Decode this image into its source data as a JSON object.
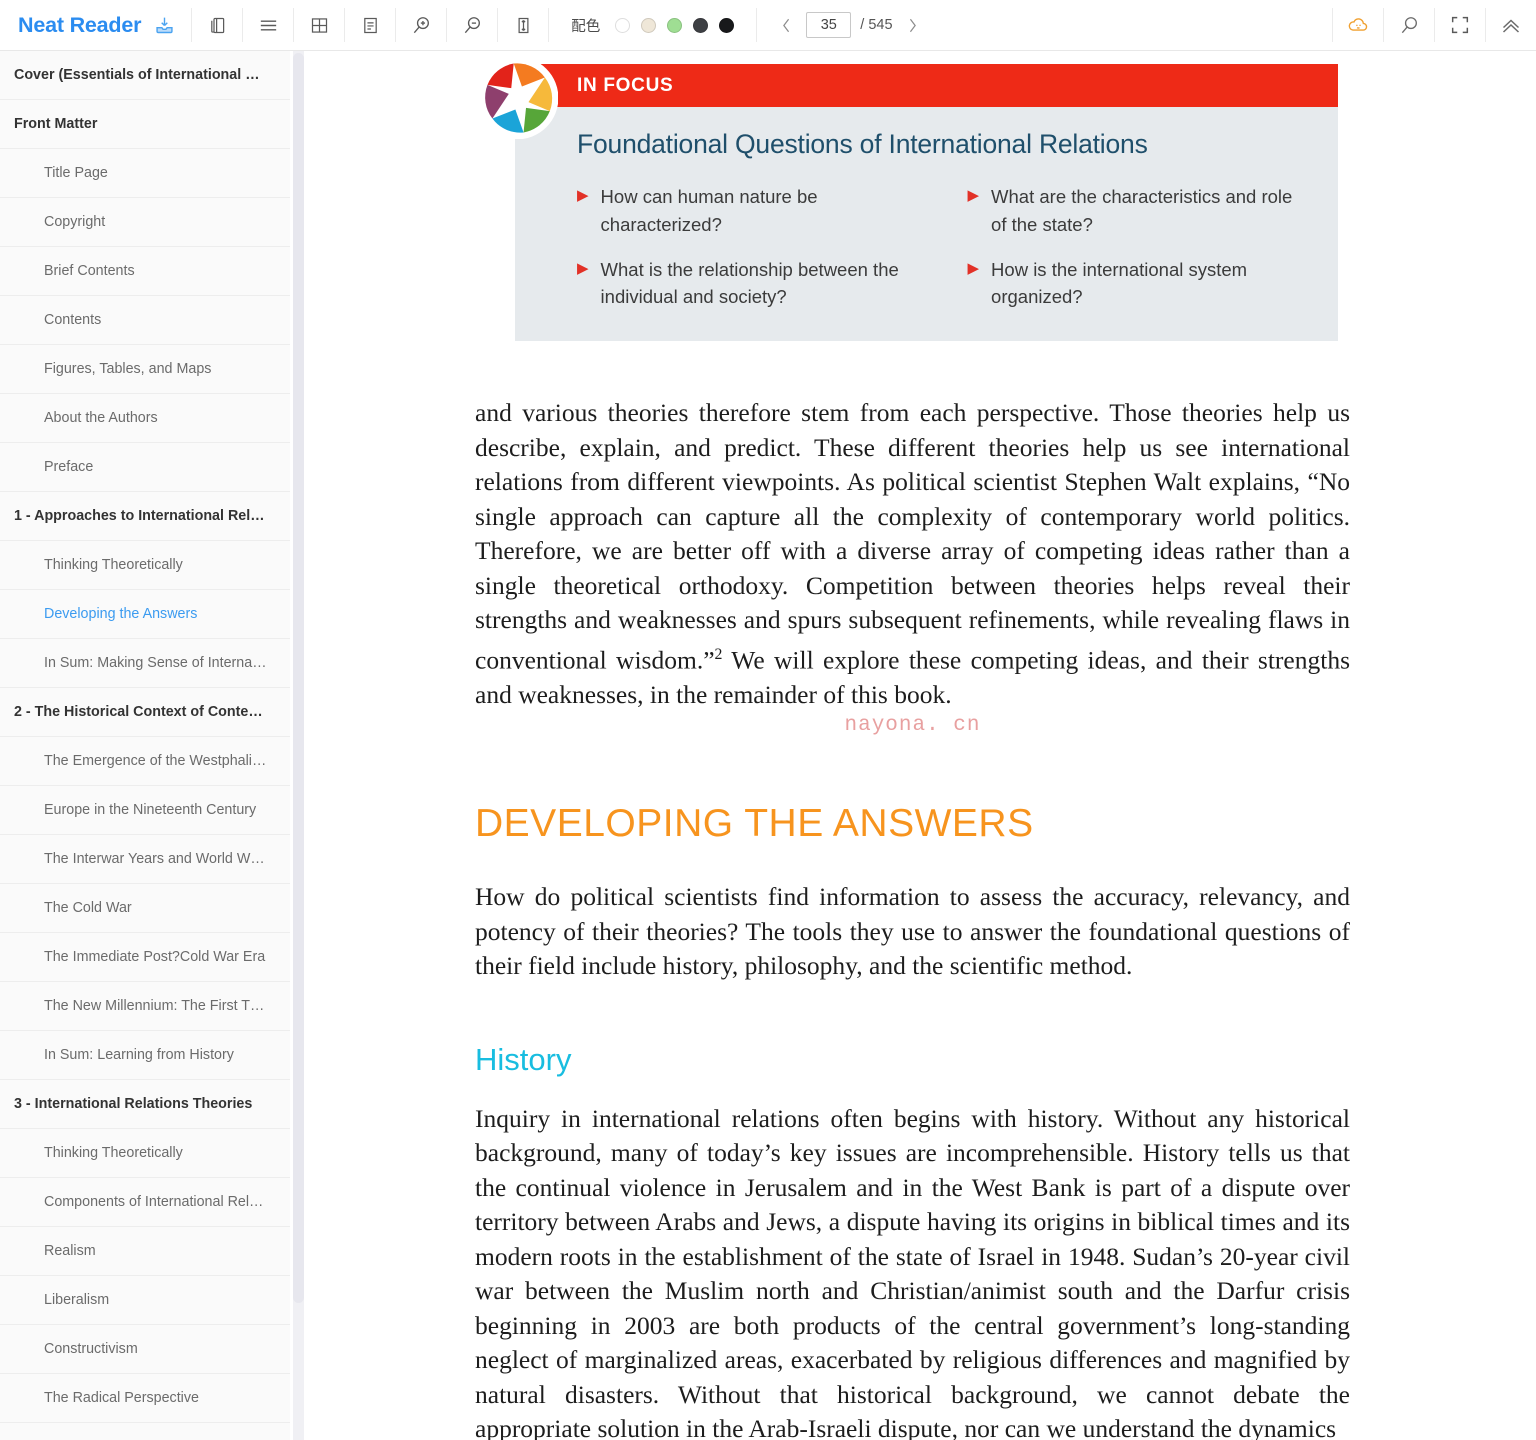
{
  "app": {
    "name": "Neat Reader"
  },
  "toolbar": {
    "save_icon": "save-download-icon",
    "icons": [
      {
        "name": "book-copy-icon",
        "label": "Book"
      },
      {
        "name": "hamburger-menu-icon",
        "label": "Contents"
      },
      {
        "name": "grid-layout-icon",
        "label": "Layout"
      },
      {
        "name": "notes-icon",
        "label": "Notes"
      },
      {
        "name": "zoom-in-icon",
        "label": "Zoom In"
      },
      {
        "name": "zoom-out-icon",
        "label": "Zoom Out"
      },
      {
        "name": "line-height-icon",
        "label": "Line Spacing"
      }
    ],
    "palette_label": "配色",
    "swatches": [
      {
        "name": "swatch-white",
        "color": "#ffffff"
      },
      {
        "name": "swatch-sepia",
        "color": "#efe7d8"
      },
      {
        "name": "swatch-green",
        "color": "#9fde93"
      },
      {
        "name": "swatch-dark-gray",
        "color": "#3e4044"
      },
      {
        "name": "swatch-black",
        "color": "#18191b"
      }
    ],
    "pager": {
      "prev": "‹",
      "next": "›",
      "current_page": "35",
      "total_pages": "/ 545",
      "placeholder": "35"
    },
    "right_icons": [
      {
        "name": "cloud-sync-icon",
        "label": "Cloud",
        "color": "#f0a030"
      },
      {
        "name": "search-icon",
        "label": "Search",
        "color": "#6b6b6b"
      },
      {
        "name": "fullscreen-icon",
        "label": "Fullscreen",
        "color": "#6b6b6b"
      },
      {
        "name": "collapse-up-icon",
        "label": "Collapse Toolbar",
        "color": "#6b6b6b"
      }
    ]
  },
  "sidebar": {
    "items": [
      {
        "label": "Cover (Essentials of International R…",
        "level": 0,
        "active": false
      },
      {
        "label": "Front Matter",
        "level": 0,
        "active": false
      },
      {
        "label": "Title Page",
        "level": 1,
        "active": false
      },
      {
        "label": "Copyright",
        "level": 1,
        "active": false
      },
      {
        "label": "Brief Contents",
        "level": 1,
        "active": false
      },
      {
        "label": "Contents",
        "level": 1,
        "active": false
      },
      {
        "label": "Figures, Tables, and Maps",
        "level": 1,
        "active": false
      },
      {
        "label": "About the Authors",
        "level": 1,
        "active": false
      },
      {
        "label": "Preface",
        "level": 1,
        "active": false
      },
      {
        "label": "1 - Approaches to International Rel…",
        "level": 0,
        "active": false
      },
      {
        "label": "Thinking Theoretically",
        "level": 1,
        "active": false
      },
      {
        "label": "Developing the Answers",
        "level": 1,
        "active": true
      },
      {
        "label": "In Sum: Making Sense of Internat…",
        "level": 1,
        "active": false
      },
      {
        "label": "2 - The Historical Context of Conte…",
        "level": 0,
        "active": false
      },
      {
        "label": "The Emergence of the Westphali…",
        "level": 1,
        "active": false
      },
      {
        "label": "Europe in the Nineteenth Century",
        "level": 1,
        "active": false
      },
      {
        "label": "The Interwar Years and World W…",
        "level": 1,
        "active": false
      },
      {
        "label": "The Cold War",
        "level": 1,
        "active": false
      },
      {
        "label": "The Immediate Post?Cold War Era",
        "level": 1,
        "active": false
      },
      {
        "label": "The New Millennium: The First T…",
        "level": 1,
        "active": false
      },
      {
        "label": "In Sum: Learning from History",
        "level": 1,
        "active": false
      },
      {
        "label": "3 - International Relations Theories",
        "level": 0,
        "active": false
      },
      {
        "label": "Thinking Theoretically",
        "level": 1,
        "active": false
      },
      {
        "label": "Components of International Rel…",
        "level": 1,
        "active": false
      },
      {
        "label": "Realism",
        "level": 1,
        "active": false
      },
      {
        "label": "Liberalism",
        "level": 1,
        "active": false
      },
      {
        "label": "Constructivism",
        "level": 1,
        "active": false
      },
      {
        "label": "The Radical Perspective",
        "level": 1,
        "active": false
      }
    ]
  },
  "content": {
    "infocus": {
      "banner_label": "IN FOCUS",
      "heading": "Foundational Questions of International Relations",
      "questions": [
        "How can human nature be characterized?",
        "What are the characteristics and role of the state?",
        "What is the relationship between the individual and society?",
        "How is the international system organized?"
      ],
      "banner_color": "#ee2a17",
      "body_color": "#e6eaed",
      "heading_color": "#1f4f6b",
      "bullet_color": "#e23127"
    },
    "paragraph_1_part1": "and various theories therefore stem from each perspective. Those theories help us describe, explain, and predict. These different theories help us see international relations from different viewpoints. As political scientist Stephen Walt explains, “No single approach can capture all the complexity of contemporary world politics. Therefore, we are better off with a diverse array of competing ideas rather than a single theoretical orthodoxy. Competition between theories helps reveal their strengths and weaknesses and spurs subsequent refinements, while revealing flaws in conventional wisdom.”",
    "paragraph_1_footnote": "2",
    "paragraph_1_part2": " We will explore these competing ideas, and their strengths and weaknesses, in the remainder of this book.",
    "watermark": "nayona. cn",
    "section_title": "DEVELOPING THE ANSWERS",
    "section_title_color": "#f7941e",
    "paragraph_2": "How do political scientists find information to assess the accuracy, relevancy, and potency of their theories? The tools they use to answer the foundational questions of their field include history, philosophy, and the scientific method.",
    "subsection_title": "History",
    "subsection_title_color": "#18bde0",
    "paragraph_3": "Inquiry in international relations often begins with history. Without any historical background, many of today’s key issues are incomprehensible. History tells us that the continual violence in Jerusalem and in the West Bank is part of a dispute over territory between Arabs and Jews, a dispute having its origins in biblical times and its modern roots in the establishment of the state of Israel in 1948. Sudan’s 20-year civil war between the Muslim north and Christian/animist south and the Darfur crisis beginning in 2003 are both products of the central government’s long-standing neglect of marginalized areas, exacerbated by religious differences and magnified by natural disasters. Without that historical background, we cannot debate the appropriate solution in the Arab-Israeli dispute, nor can we understand the dynamics"
  }
}
